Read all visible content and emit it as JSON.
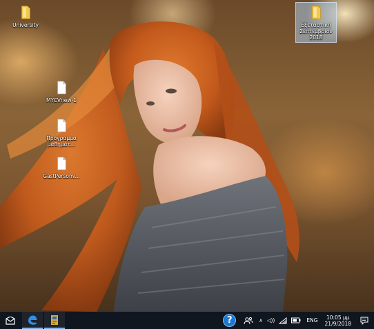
{
  "desktop": {
    "icons": [
      {
        "label": "University",
        "type": "folder"
      },
      {
        "label": "Εξεταστική Σεπτεμβρίου 2018",
        "type": "folder"
      },
      {
        "label": "MYCVnew-1",
        "type": "file"
      },
      {
        "label": "Προγραμμα μαθημάτ...",
        "type": "file"
      },
      {
        "label": "GastPersonv...",
        "type": "file"
      }
    ]
  },
  "taskbar": {
    "start_icon": "start-icon",
    "pinned": [
      {
        "name": "edge-icon"
      },
      {
        "name": "file-app-icon"
      }
    ],
    "tray": {
      "help_glyph": "?",
      "language": "ENG",
      "volume_glyph": "◁))",
      "chevron_glyph": "∧",
      "time": "10:05 μμ",
      "date": "21/9/2018"
    }
  },
  "colors": {
    "taskbar_bg": "#10161f",
    "accent": "#1c78d2",
    "folder": "#f2c94c"
  }
}
